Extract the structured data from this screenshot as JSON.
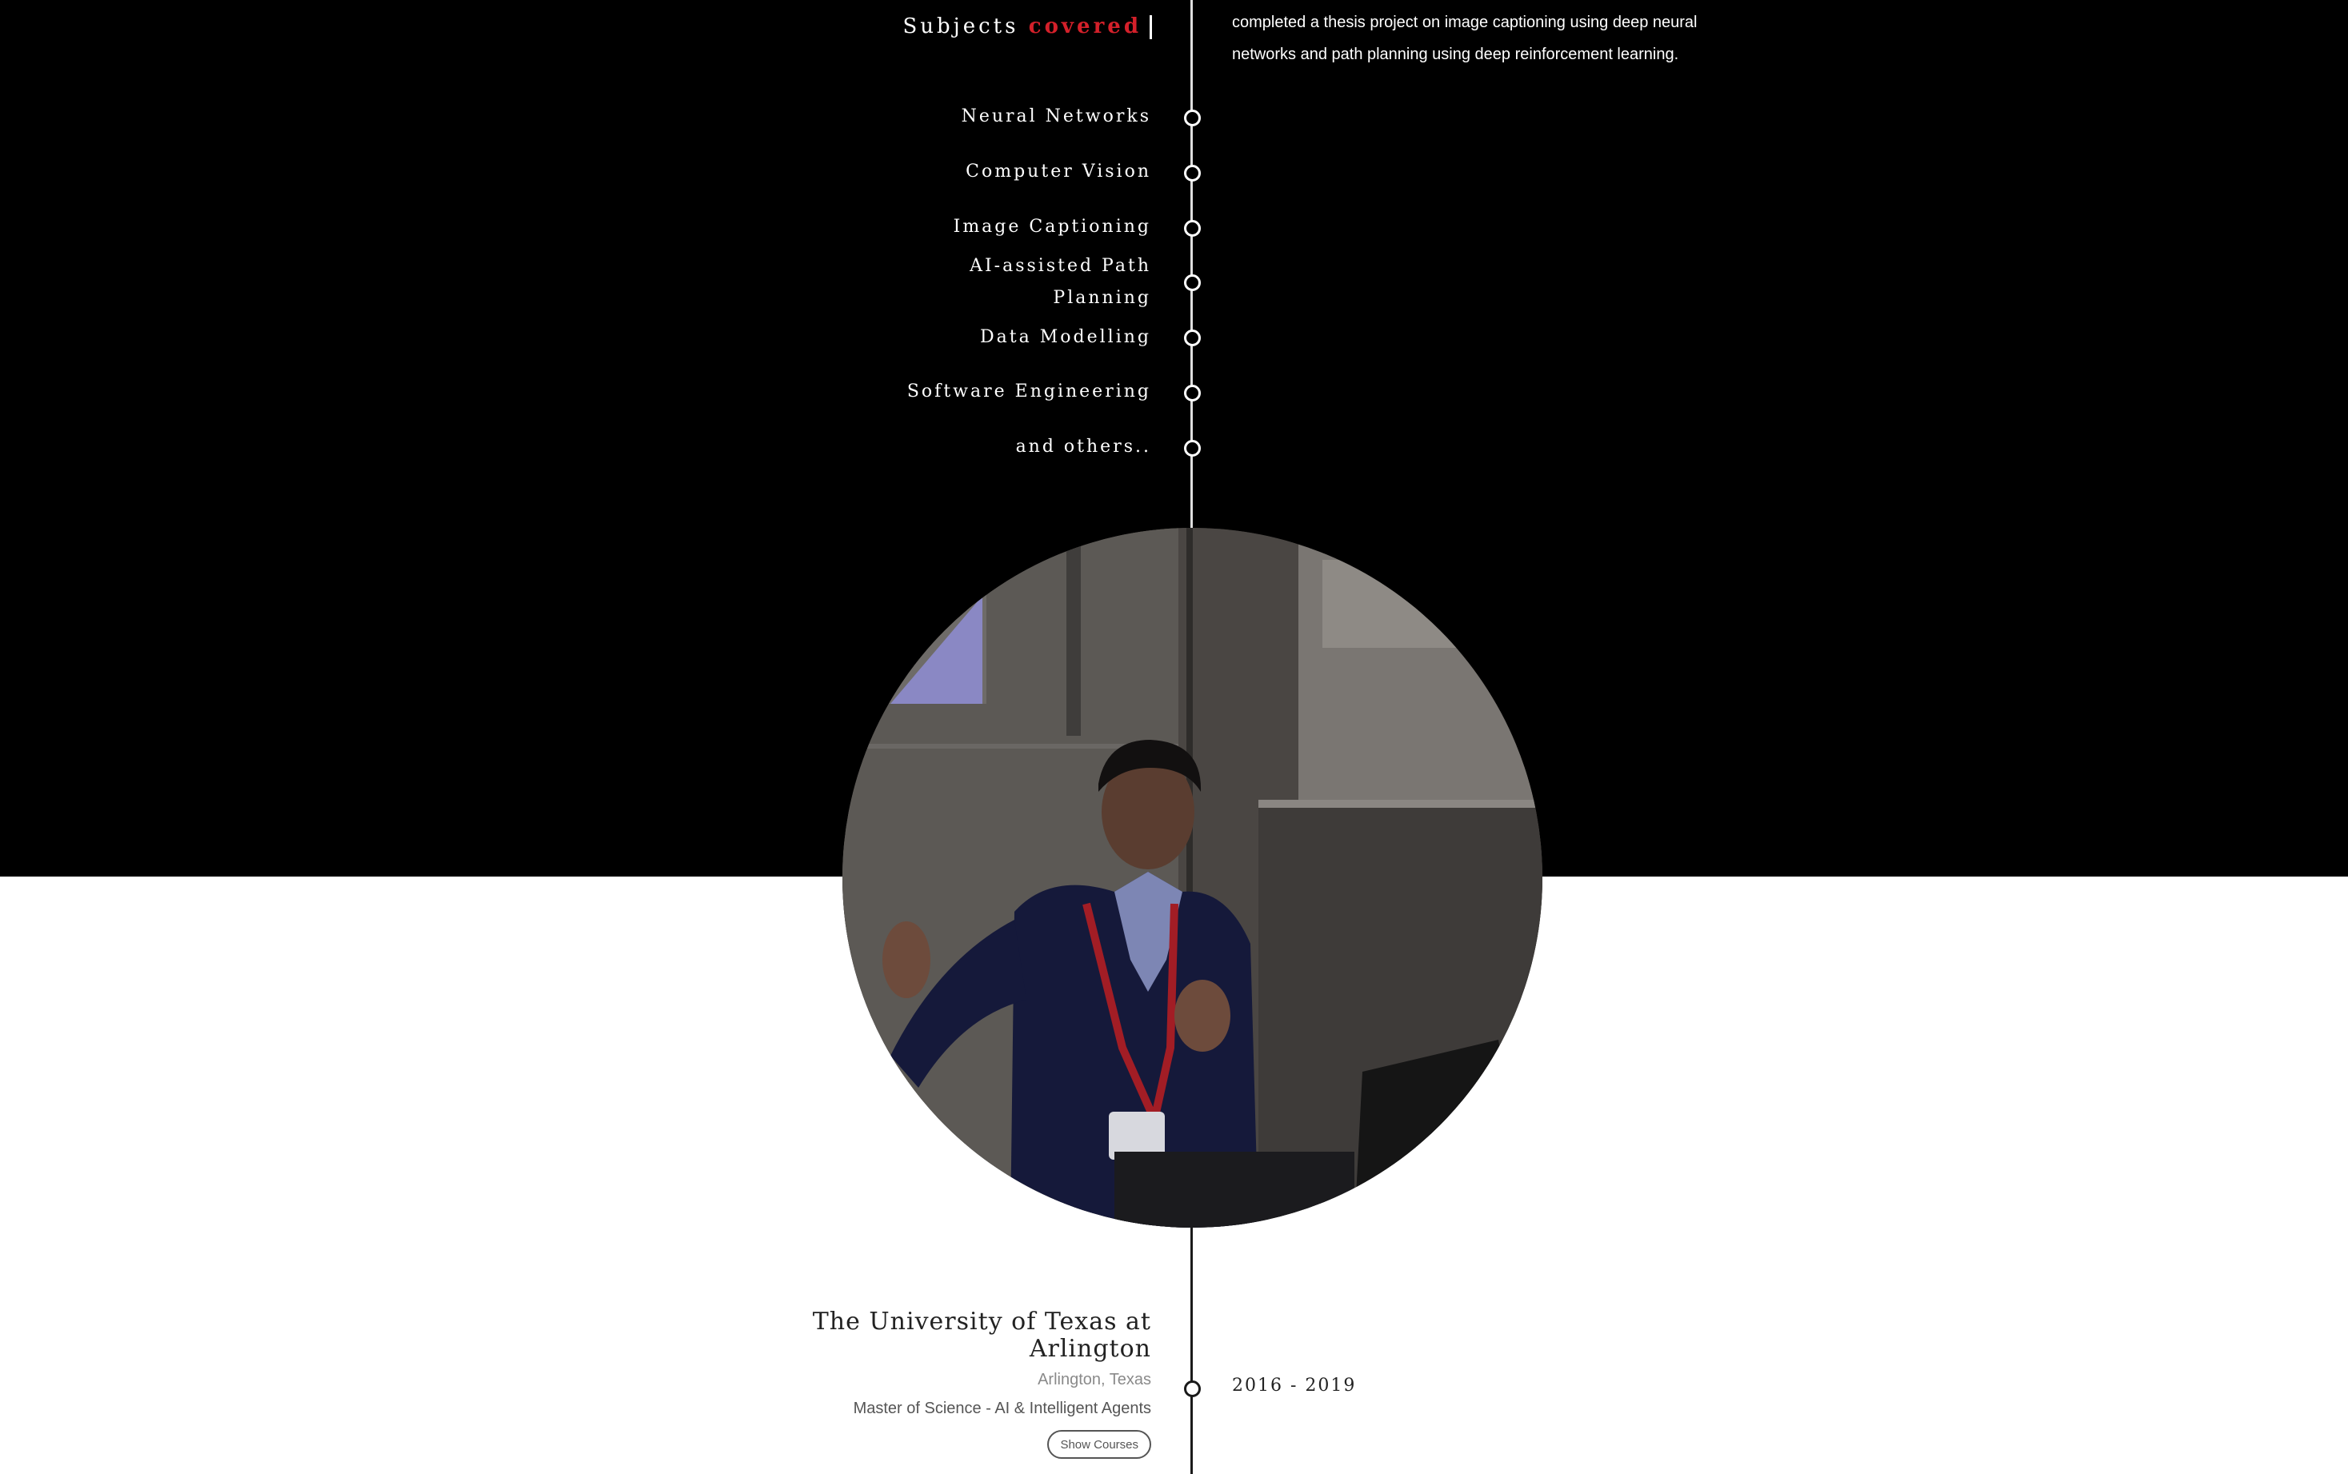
{
  "subjects": {
    "title_main": "Subjects",
    "title_accent": "covered",
    "items": [
      "Neural Networks",
      "Computer Vision",
      "Image Captioning",
      "AI-assisted Path Planning",
      "Data Modelling",
      "Software Engineering",
      "and others.."
    ]
  },
  "description": {
    "text": "completed a thesis project on image captioning using deep neural networks and path planning using deep reinforcement learning."
  },
  "education": {
    "institution": "The University of Texas at Arlington",
    "location": "Arlington, Texas",
    "degree": "Master of Science - AI & Intelligent Agents",
    "show_courses_label": "Show Courses",
    "years": "2016 - 2019"
  },
  "colors": {
    "accent": "#d4202a",
    "dark_background": "#000000",
    "light_background": "#ffffff"
  }
}
